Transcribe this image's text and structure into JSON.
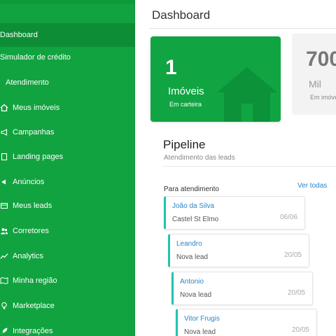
{
  "sidebar": {
    "items": [
      {
        "label": "Dashboard",
        "icon": "none",
        "active": true
      },
      {
        "label": "Simulador de crédito",
        "icon": "calculator-icon"
      },
      {
        "label": "Atendimento",
        "icon": "chat-icon"
      },
      {
        "label": "Meus imóveis",
        "icon": "home-icon"
      },
      {
        "label": "Campanhas",
        "icon": "megaphone-icon"
      },
      {
        "label": "Landing pages",
        "icon": "page-icon"
      },
      {
        "label": "Anúncios",
        "icon": "ads-icon"
      },
      {
        "label": "Meus leads",
        "icon": "leads-icon"
      },
      {
        "label": "Corretores",
        "icon": "users-icon"
      },
      {
        "label": "Analytics",
        "icon": "chart-line-icon"
      },
      {
        "label": "Minha região",
        "icon": "map-icon"
      },
      {
        "label": "Marketplace",
        "icon": "lightbulb-icon"
      },
      {
        "label": "Integrações",
        "icon": "rocket-icon"
      }
    ]
  },
  "header": {
    "title": "Dashboard"
  },
  "stats": {
    "card1": {
      "value": "1",
      "label": "Imóveis",
      "sub": "Em carteira"
    },
    "card2": {
      "value": "700",
      "label": "Mil",
      "sub": "Em imóve"
    }
  },
  "pipeline": {
    "title": "Pipeline",
    "subtitle": "Atendimento das leads",
    "column_title": "Para atendimento",
    "see_all": "Ver todas",
    "leads": [
      {
        "name": "João da Silva",
        "status": "Castel St Elmo",
        "date": "06/06"
      },
      {
        "name": "Leandro",
        "status": "Nova lead",
        "date": "20/05"
      },
      {
        "name": "Antonio",
        "status": "Nova lead",
        "date": "20/05"
      },
      {
        "name": "Vitor Frugis",
        "status": "Nova lead",
        "date": "20/05"
      }
    ]
  },
  "colors": {
    "sidebar": "#11a33f",
    "card_green": "#10a542",
    "accent_link": "#2a85c6",
    "lead_border": "#22c3b0"
  }
}
